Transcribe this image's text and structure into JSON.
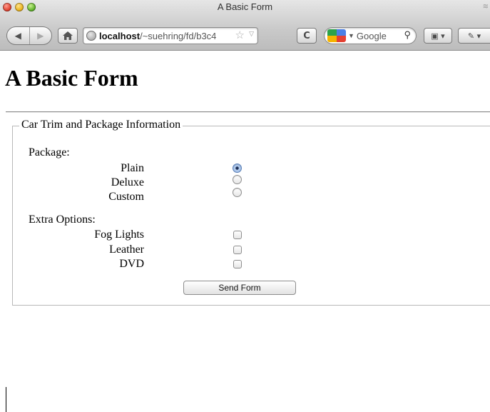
{
  "window": {
    "title": "A Basic Form",
    "title_extra": "≋"
  },
  "toolbar": {
    "back_icon": "back-arrow-icon",
    "forward_icon": "forward-arrow-icon",
    "home_icon": "home-icon",
    "url_host": "localhost",
    "url_path": "/~suehring/fd/b3c4",
    "reload_icon": "reload-icon",
    "search_placeholder": "Google",
    "search_engine_icon": "google-logo-icon",
    "bookmarks_icon": "bookmarks-icon",
    "tools_icon": "wrench-icon"
  },
  "page": {
    "heading": "A Basic Form",
    "fieldset_legend": "Car Trim and Package Information",
    "package_label": "Package:",
    "packages": [
      {
        "label": "Plain",
        "checked": true
      },
      {
        "label": "Deluxe",
        "checked": false
      },
      {
        "label": "Custom",
        "checked": false
      }
    ],
    "extras_label": "Extra Options:",
    "extras": [
      {
        "label": "Fog Lights",
        "checked": false
      },
      {
        "label": "Leather",
        "checked": false
      },
      {
        "label": "DVD",
        "checked": false
      }
    ],
    "submit_label": "Send Form"
  },
  "colors": {
    "radio_selected": "#5a7fb6",
    "chrome_bg": "#c9c9c9"
  }
}
